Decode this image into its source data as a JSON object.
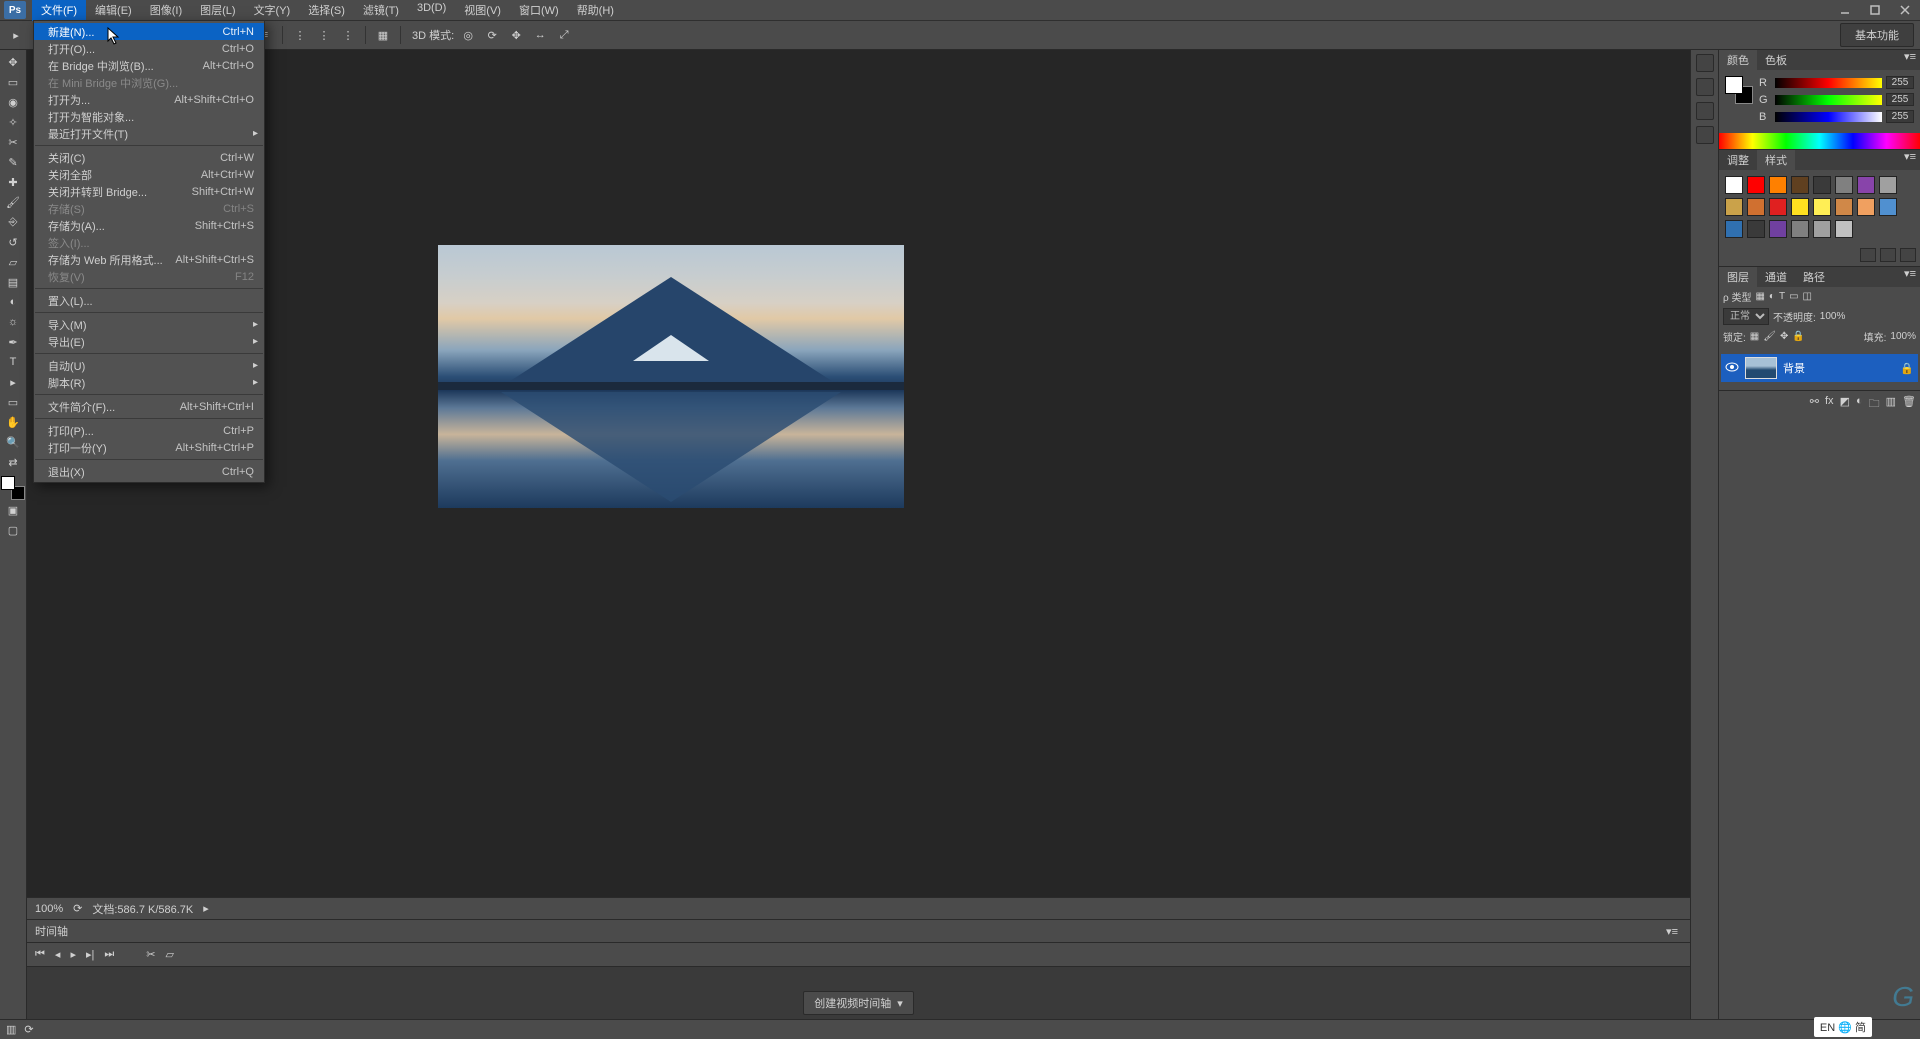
{
  "menubar": {
    "items": [
      "文件(F)",
      "编辑(E)",
      "图像(I)",
      "图层(L)",
      "文字(Y)",
      "选择(S)",
      "滤镜(T)",
      "3D(D)",
      "视图(V)",
      "窗口(W)",
      "帮助(H)"
    ]
  },
  "file_menu": {
    "groups": [
      [
        {
          "label": "新建(N)...",
          "shortcut": "Ctrl+N",
          "hover": true
        },
        {
          "label": "打开(O)...",
          "shortcut": "Ctrl+O"
        },
        {
          "label": "在 Bridge 中浏览(B)...",
          "shortcut": "Alt+Ctrl+O"
        },
        {
          "label": "在 Mini Bridge 中浏览(G)...",
          "disabled": true
        },
        {
          "label": "打开为...",
          "shortcut": "Alt+Shift+Ctrl+O"
        },
        {
          "label": "打开为智能对象..."
        },
        {
          "label": "最近打开文件(T)",
          "submenu": true
        }
      ],
      [
        {
          "label": "关闭(C)",
          "shortcut": "Ctrl+W"
        },
        {
          "label": "关闭全部",
          "shortcut": "Alt+Ctrl+W"
        },
        {
          "label": "关闭并转到 Bridge...",
          "shortcut": "Shift+Ctrl+W"
        },
        {
          "label": "存储(S)",
          "shortcut": "Ctrl+S",
          "disabled": true
        },
        {
          "label": "存储为(A)...",
          "shortcut": "Shift+Ctrl+S"
        },
        {
          "label": "签入(I)...",
          "disabled": true
        },
        {
          "label": "存储为 Web 所用格式...",
          "shortcut": "Alt+Shift+Ctrl+S"
        },
        {
          "label": "恢复(V)",
          "shortcut": "F12",
          "disabled": true
        }
      ],
      [
        {
          "label": "置入(L)..."
        }
      ],
      [
        {
          "label": "导入(M)",
          "submenu": true
        },
        {
          "label": "导出(E)",
          "submenu": true
        }
      ],
      [
        {
          "label": "自动(U)",
          "submenu": true
        },
        {
          "label": "脚本(R)",
          "submenu": true
        }
      ],
      [
        {
          "label": "文件简介(F)...",
          "shortcut": "Alt+Shift+Ctrl+I"
        }
      ],
      [
        {
          "label": "打印(P)...",
          "shortcut": "Ctrl+P"
        },
        {
          "label": "打印一份(Y)",
          "shortcut": "Alt+Shift+Ctrl+P"
        }
      ],
      [
        {
          "label": "退出(X)",
          "shortcut": "Ctrl+Q"
        }
      ]
    ]
  },
  "optionsbar": {
    "mode_label": "3D 模式:",
    "workspace": "基本功能"
  },
  "status": {
    "zoom": "100%",
    "doc": "文档:586.7 K/586.7K"
  },
  "timeline": {
    "tab": "时间轴",
    "create_btn": "创建视频时间轴"
  },
  "panels": {
    "color": {
      "tabs": [
        "颜色",
        "色板"
      ],
      "r": "R",
      "g": "G",
      "b": "B",
      "r_val": "255",
      "g_val": "255",
      "b_val": "255"
    },
    "adjust": {
      "tabs": [
        "调整",
        "样式"
      ]
    },
    "swatches": [
      "#ffffff",
      "#ff0000",
      "#ff8000",
      "#604020",
      "#3a3a3a",
      "#808080",
      "#8844aa",
      "#a0a0a0",
      "#caa24a",
      "#d07030",
      "#e02020",
      "#ffe020",
      "#ffee55",
      "#d08848",
      "#f0a060",
      "#5090d0",
      "#3070b0",
      "#3a3a3a",
      "#7040a0",
      "#808080",
      "#a0a0a0",
      "#c0c0c0"
    ],
    "layers": {
      "tabs": [
        "图层",
        "通道",
        "路径"
      ],
      "kind_label": "ρ 类型",
      "blend": "正常",
      "opacity_label": "不透明度:",
      "opacity_val": "100%",
      "lock_label": "锁定:",
      "fill_label": "填充:",
      "fill_val": "100%",
      "layer_name": "背景"
    }
  },
  "ime": "EN 🌐 简"
}
